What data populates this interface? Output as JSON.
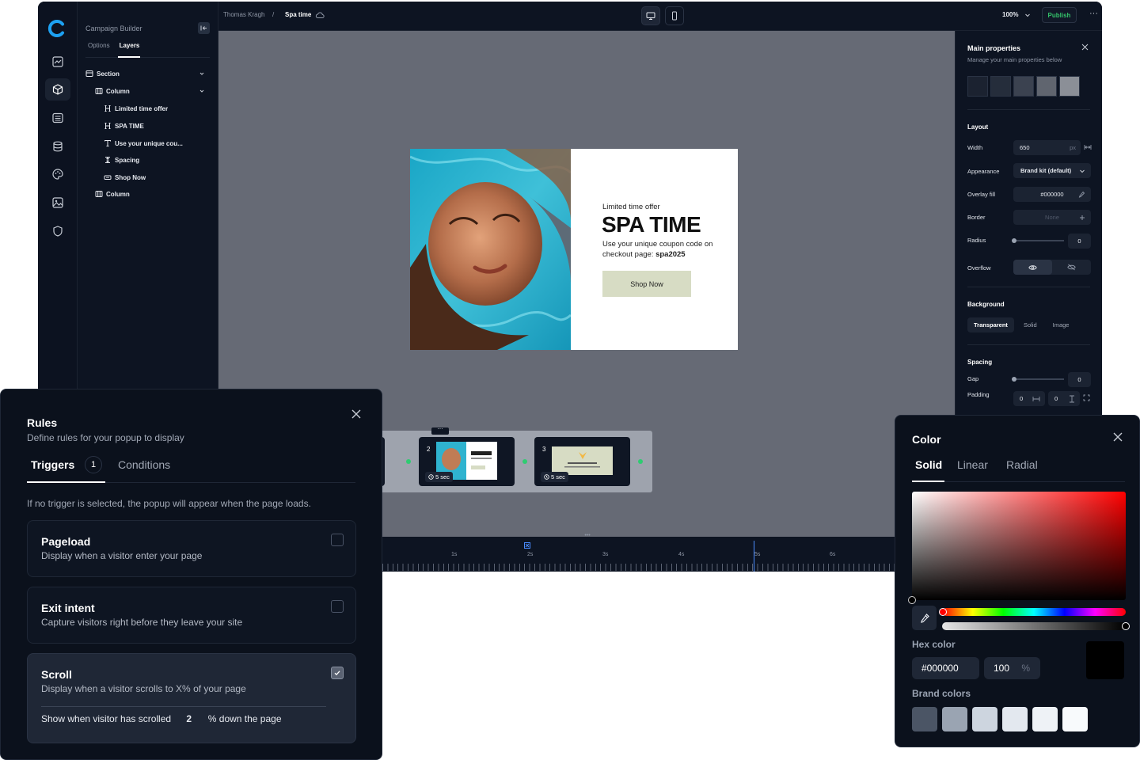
{
  "sidebar_rail": {
    "icons": [
      "logo-icon",
      "chart-icon",
      "cube-icon",
      "list-icon",
      "database-icon",
      "palette-icon",
      "image-icon",
      "shield-icon"
    ]
  },
  "layers_panel": {
    "title": "Campaign Builder",
    "tabs": [
      {
        "label": "Options"
      },
      {
        "label": "Layers"
      }
    ],
    "tree": [
      {
        "label": "Section",
        "icon": "section-icon"
      },
      {
        "label": "Column",
        "icon": "column-icon"
      },
      {
        "label": "Limited time offer",
        "icon": "heading-icon"
      },
      {
        "label": "SPA TIME",
        "icon": "heading-icon"
      },
      {
        "label": "Use your unique cou...",
        "icon": "text-icon"
      },
      {
        "label": "Spacing",
        "icon": "spacing-icon"
      },
      {
        "label": "Shop Now",
        "icon": "button-icon"
      },
      {
        "label": "Column",
        "icon": "column-icon"
      }
    ]
  },
  "topbar": {
    "breadcrumb_user": "Thomas Kragh",
    "breadcrumb_sep": "/",
    "breadcrumb_page": "Spa time",
    "zoom": "100%",
    "publish_label": "Publish",
    "more_label": "···"
  },
  "popup": {
    "kicker": "Limited time offer",
    "title": "SPA TIME",
    "text": "Use your unique coupon code on  checkout page:",
    "code": "spa2025",
    "button": "Shop Now"
  },
  "props": {
    "title": "Main properties",
    "subtitle": "Manage your main properties below",
    "swatches": [
      "#1b2230",
      "#252d3b",
      "#3b4250",
      "#60656f",
      "#8b8f97"
    ],
    "layout_heading": "Layout",
    "width_label": "Width",
    "width_value": "650",
    "width_unit": "px",
    "appearance_label": "Appearance",
    "appearance_value": "Brand kit (default)",
    "overlay_label": "Overlay fill",
    "overlay_value": "#000000",
    "border_label": "Border",
    "border_value": "None",
    "radius_label": "Radius",
    "radius_value": "0",
    "overflow_label": "Overflow",
    "background_heading": "Background",
    "bg_tabs": [
      "Transparent",
      "Solid",
      "Image"
    ],
    "spacing_heading": "Spacing",
    "gap_label": "Gap",
    "gap_value": "0",
    "padding_label": "Padding",
    "padding_h": "0",
    "padding_v": "0"
  },
  "timeline": {
    "cards": [
      {
        "num": "",
        "time": ""
      },
      {
        "num": "2",
        "time": "5 sec"
      },
      {
        "num": "3",
        "time": "5 sec"
      }
    ],
    "ruler_labels": [
      "1s",
      "2s",
      "3s",
      "4s",
      "5s",
      "6s"
    ]
  },
  "rules": {
    "title": "Rules",
    "subtitle": "Define rules for your popup to display",
    "tabs": [
      {
        "label": "Triggers",
        "count": "1"
      },
      {
        "label": "Conditions"
      }
    ],
    "info": "If no trigger is selected, the popup will appear when the page loads.",
    "options": [
      {
        "title": "Pageload",
        "desc": "Display when a visitor enter your page",
        "checked": false
      },
      {
        "title": "Exit intent",
        "desc": "Capture visitors right before they leave your site",
        "checked": false
      },
      {
        "title": "Scroll",
        "desc": "Display when a visitor scrolls to X% of your page",
        "checked": true
      }
    ],
    "scroll_prefix": "Show when visitor has scrolled",
    "scroll_value": "2",
    "scroll_suffix": "% down the page"
  },
  "color_picker": {
    "title": "Color",
    "tabs": [
      "Solid",
      "Linear",
      "Radial"
    ],
    "hex_label": "Hex color",
    "hex_value": "#000000",
    "opacity_value": "100",
    "opacity_unit": "%",
    "brand_label": "Brand colors",
    "brand_colors": [
      "#4b5565",
      "#9aa4b2",
      "#cdd5df",
      "#e3e8ef",
      "#eef2f6",
      "#f8fafc"
    ]
  }
}
